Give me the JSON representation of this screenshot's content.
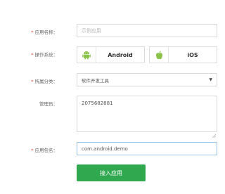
{
  "form": {
    "app_name": {
      "label": "应用名称：",
      "placeholder": "示例应用",
      "value": ""
    },
    "os": {
      "label": "操作系统：",
      "options": [
        {
          "name": "Android",
          "icon": "android-icon"
        },
        {
          "name": "iOS",
          "icon": "apple-icon"
        }
      ]
    },
    "category": {
      "label": "所属分类：",
      "selected": "软件开发工具"
    },
    "admins": {
      "label": "管理员：",
      "value": "2075682881"
    },
    "package_name": {
      "label": "应用包名：",
      "value": "com.android.demo"
    },
    "submit_label": "接入应用"
  },
  "colors": {
    "accent": "#2fa84f",
    "required": "#e03b3b",
    "android": "#8bc34a"
  }
}
